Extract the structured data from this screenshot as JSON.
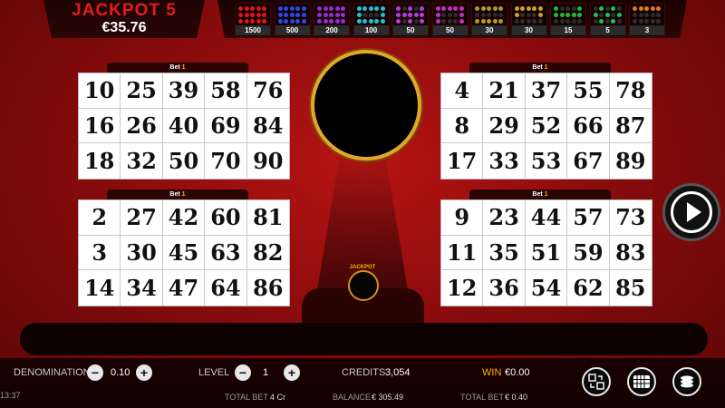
{
  "jackpot": {
    "title": "JACKPOT 5",
    "amount": "€35.76"
  },
  "patterns": [
    {
      "pay": "1500",
      "color": "#e01515",
      "cells": [
        1,
        1,
        1,
        1,
        1,
        1,
        1,
        1,
        1,
        1,
        1,
        1,
        1,
        1,
        1
      ]
    },
    {
      "pay": "500",
      "color": "#2a48e8",
      "cells": [
        1,
        1,
        1,
        1,
        1,
        1,
        1,
        1,
        1,
        1,
        1,
        1,
        1,
        1,
        1
      ]
    },
    {
      "pay": "200",
      "color": "#9a2ad0",
      "cells": [
        1,
        1,
        1,
        1,
        1,
        1,
        1,
        1,
        1,
        1,
        1,
        1,
        1,
        1,
        1
      ]
    },
    {
      "pay": "100",
      "color": "#1cc4d8",
      "cells": [
        1,
        1,
        1,
        1,
        1,
        1,
        0,
        0,
        0,
        1,
        1,
        1,
        1,
        1,
        1
      ]
    },
    {
      "pay": "50",
      "color": "#b33ee0",
      "cells": [
        1,
        0,
        1,
        0,
        1,
        1,
        1,
        1,
        1,
        1,
        1,
        0,
        1,
        0,
        1
      ]
    },
    {
      "pay": "50",
      "color": "#c42ec4",
      "cells": [
        1,
        1,
        1,
        1,
        1,
        1,
        0,
        0,
        0,
        1,
        1,
        0,
        0,
        0,
        1
      ]
    },
    {
      "pay": "30",
      "color": "#b49a2a",
      "cells": [
        1,
        1,
        1,
        1,
        1,
        0,
        0,
        0,
        0,
        0,
        1,
        1,
        1,
        1,
        1
      ]
    },
    {
      "pay": "30",
      "color": "#c9a22a",
      "cells": [
        1,
        1,
        1,
        1,
        1,
        1,
        0,
        0,
        0,
        1,
        0,
        0,
        0,
        0,
        0
      ]
    },
    {
      "pay": "15",
      "color": "#22b83a",
      "cells": [
        1,
        0,
        0,
        0,
        1,
        1,
        1,
        1,
        1,
        1,
        0,
        0,
        0,
        0,
        0
      ]
    },
    {
      "pay": "5",
      "color": "#1fc24a",
      "cells": [
        0,
        1,
        0,
        1,
        0,
        1,
        0,
        1,
        0,
        1,
        0,
        1,
        0,
        1,
        0
      ]
    },
    {
      "pay": "3",
      "color": "#e07a1a",
      "cells": [
        1,
        1,
        1,
        1,
        1,
        0,
        0,
        0,
        0,
        0,
        0,
        0,
        0,
        0,
        0
      ]
    }
  ],
  "cards": [
    {
      "bet_label": "Bet",
      "bet_value": "1",
      "numbers": [
        "10",
        "25",
        "39",
        "58",
        "76",
        "16",
        "26",
        "40",
        "69",
        "84",
        "18",
        "32",
        "50",
        "70",
        "90"
      ]
    },
    {
      "bet_label": "Bet",
      "bet_value": "1",
      "numbers": [
        "4",
        "21",
        "37",
        "55",
        "78",
        "8",
        "29",
        "52",
        "66",
        "87",
        "17",
        "33",
        "53",
        "67",
        "89"
      ]
    },
    {
      "bet_label": "Bet",
      "bet_value": "1",
      "numbers": [
        "2",
        "27",
        "42",
        "60",
        "81",
        "3",
        "30",
        "45",
        "63",
        "82",
        "14",
        "34",
        "47",
        "64",
        "86"
      ]
    },
    {
      "bet_label": "Bet",
      "bet_value": "1",
      "numbers": [
        "9",
        "23",
        "44",
        "57",
        "73",
        "11",
        "35",
        "51",
        "59",
        "83",
        "12",
        "36",
        "54",
        "62",
        "85"
      ]
    }
  ],
  "mini_ball_label": "JACKPOT",
  "bottom": {
    "denomination_label": "DENOMINATION",
    "denomination_value": "0.10",
    "level_label": "LEVEL",
    "level_value": "1",
    "credits_label": "CREDITS",
    "credits_value": "3,054",
    "win_label": "WIN",
    "win_value": "€0.00",
    "total_bet_label": "TOTAL BET",
    "total_bet_cr": "4 Cr",
    "balance_label": "BALANCE",
    "balance_value": "€ 305.49",
    "total_bet_label2": "TOTAL BET",
    "total_bet_eur": "€ 0.40",
    "clock": "13:37",
    "minus": "−",
    "plus": "+"
  }
}
